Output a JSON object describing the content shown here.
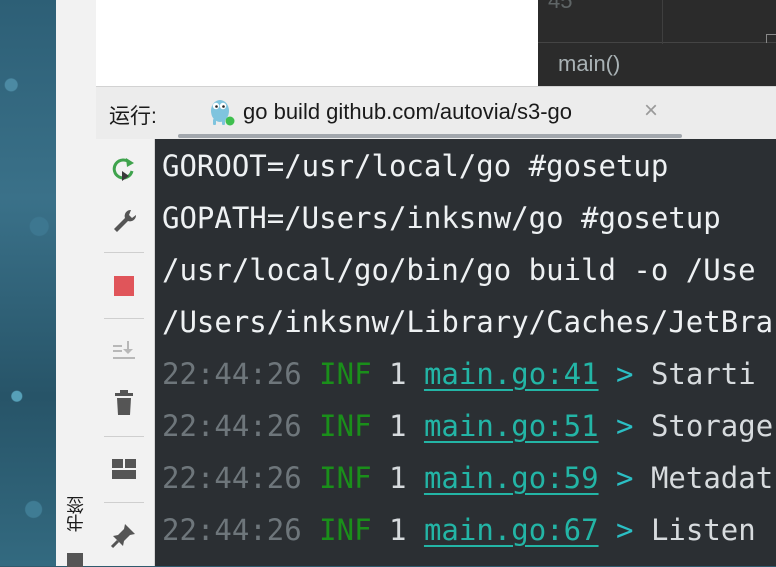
{
  "editor": {
    "line_number": "45",
    "breadcrumb": "main()"
  },
  "sidebar": {
    "bookmarks_label": "书签"
  },
  "run_panel": {
    "label": "运行:",
    "tab_title": "go build github.com/autovia/s3-go",
    "close_symbol": "×"
  },
  "toolbar": {
    "buttons": [
      "rerun-icon",
      "wrench-icon",
      "stop-icon",
      "scroll-to-end-icon",
      "trash-icon",
      "layout-icon",
      "pin-icon"
    ]
  },
  "console": {
    "env_lines": [
      "GOROOT=/usr/local/go #gosetup",
      "GOPATH=/Users/inksnw/go #gosetup",
      "/usr/local/go/bin/go build -o /Use",
      "/Users/inksnw/Library/Caches/JetBra"
    ],
    "log_lines": [
      {
        "time": "22:44:26",
        "level": "INF",
        "count": "1",
        "source": "main.go:41",
        "arrow": ">",
        "message": "Starti"
      },
      {
        "time": "22:44:26",
        "level": "INF",
        "count": "1",
        "source": "main.go:51",
        "arrow": ">",
        "message": "Storage"
      },
      {
        "time": "22:44:26",
        "level": "INF",
        "count": "1",
        "source": "main.go:59",
        "arrow": ">",
        "message": "Metadat"
      },
      {
        "time": "22:44:26",
        "level": "INF",
        "count": "1",
        "source": "main.go:67",
        "arrow": ">",
        "message": "Listen"
      }
    ]
  },
  "colors": {
    "console_bg": "#2b2f33",
    "log_level": "#1a8f1a",
    "link": "#23b5a6",
    "stop_red": "#e0555a",
    "rerun_green": "#3fa34d"
  }
}
